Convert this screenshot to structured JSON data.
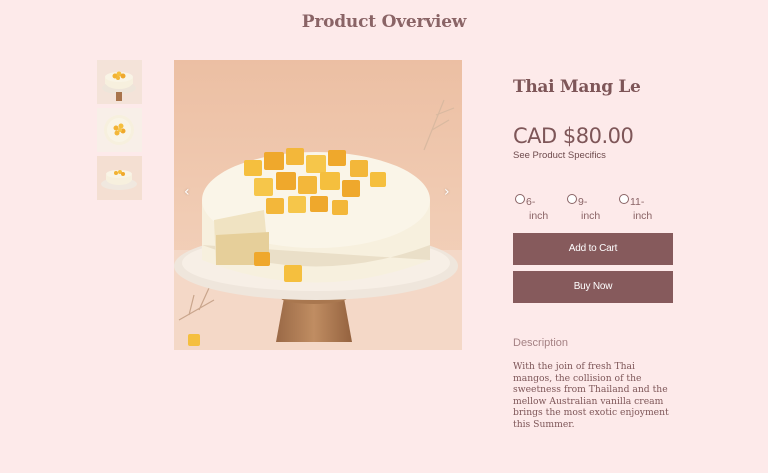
{
  "page": {
    "title": "Product Overview"
  },
  "gallery": {
    "thumbnails": [
      {
        "icon": "cake-side-view-thumbnail"
      },
      {
        "icon": "cake-top-view-thumbnail"
      },
      {
        "icon": "cake-plate-thumbnail"
      }
    ],
    "prev_arrow": "‹",
    "next_arrow": "›"
  },
  "product": {
    "name": "Thai Mang Le",
    "price": "CAD $80.00",
    "specifics_link": "See Product Specifics",
    "sizes": [
      {
        "number": "6-",
        "unit": "inch"
      },
      {
        "number": "9-",
        "unit": "inch"
      },
      {
        "number": "11-",
        "unit": "inch"
      }
    ],
    "add_to_cart_label": "Add to Cart",
    "buy_now_label": "Buy Now",
    "description_heading": "Description",
    "description": "With the join of fresh Thai mangos, the collision of the sweetness from Thailand and the mellow Australian vanilla cream brings the most exotic enjoyment this Summer."
  },
  "colors": {
    "background": "#fdeaea",
    "button": "#865a5c",
    "mango": "#f3b73a",
    "cream": "#f7f2df"
  }
}
